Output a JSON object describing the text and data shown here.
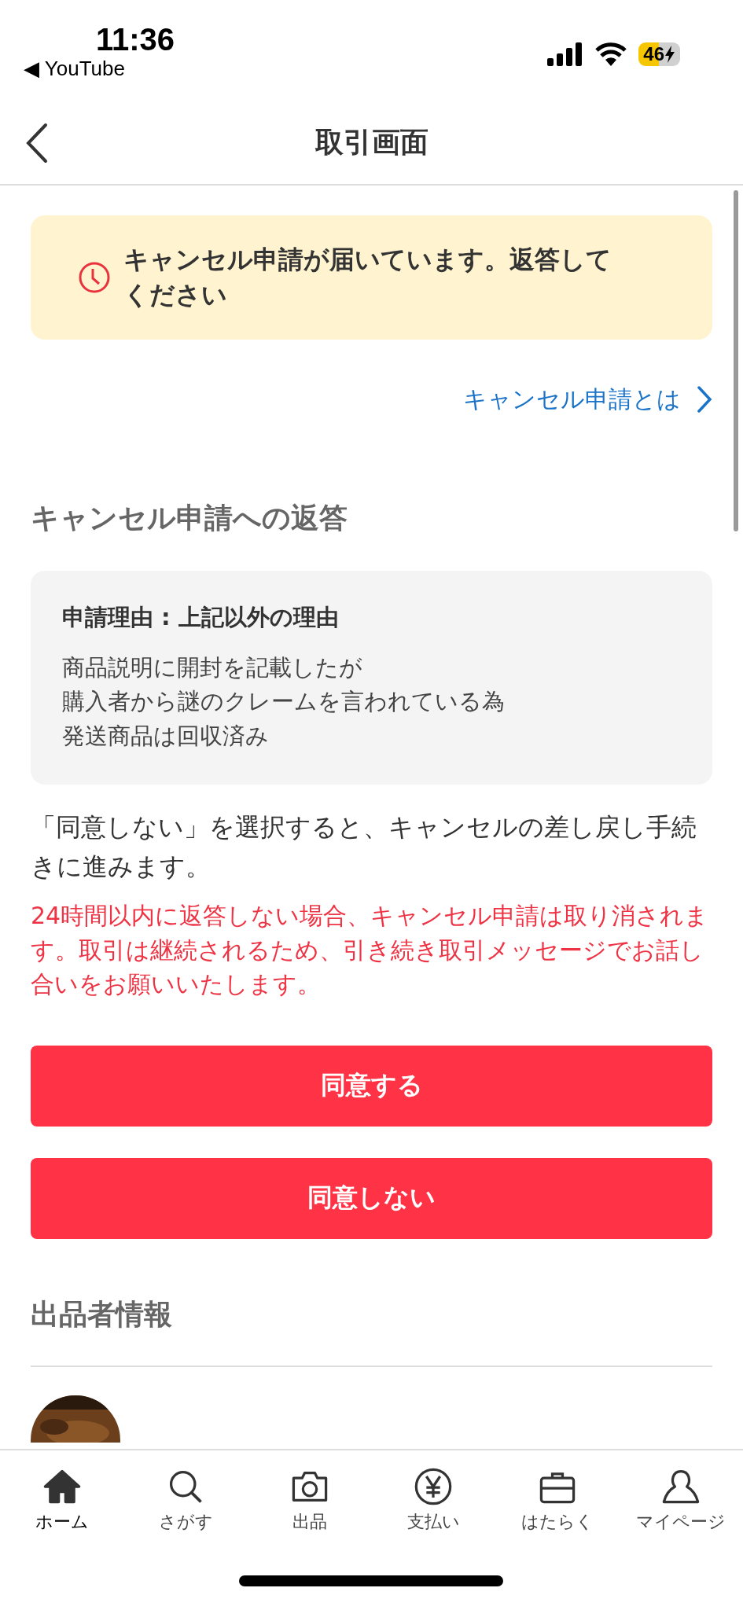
{
  "status_bar": {
    "time": "11:36",
    "back_app": "◀ YouTube",
    "battery": "46"
  },
  "nav": {
    "title": "取引画面"
  },
  "notice": {
    "text": "キャンセル申請が届いています。返答してください"
  },
  "help_link": {
    "label": "キャンセル申請とは"
  },
  "response": {
    "heading": "キャンセル申請への返答",
    "reason_title": "申請理由 : 上記以外の理由",
    "reason_lines": [
      "商品説明に開封を記載したが",
      "購入者から謎のクレームを言われている為",
      "発送商品は回収済み"
    ]
  },
  "explanation": "「同意しない」を選択すると、キャンセルの差し戻し手続きに進みます。",
  "warning": "24時間以内に返答しない場合、キャンセル申請は取り消されます。取引は継続されるため、引き続き取引メッセージでお話し合いをお願いいたします。",
  "buttons": [
    "同意する",
    "同意しない"
  ],
  "seller": {
    "heading": "出品者情報"
  },
  "tab_bar": [
    {
      "label": "ホーム",
      "selected": true
    },
    {
      "label": "さがす",
      "selected": false
    },
    {
      "label": "出品",
      "selected": false
    },
    {
      "label": "支払い",
      "selected": false
    },
    {
      "label": "はたらく",
      "selected": false
    },
    {
      "label": "マイページ",
      "selected": false
    }
  ]
}
